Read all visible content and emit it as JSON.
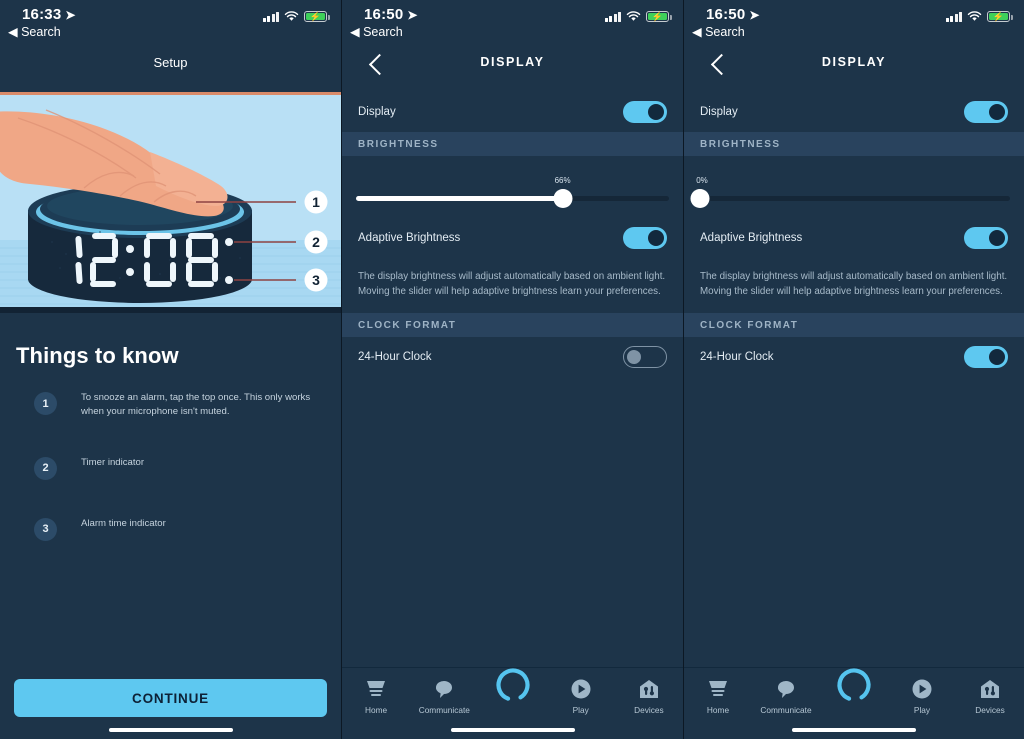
{
  "panels": [
    {
      "status": {
        "time": "16:33",
        "back": "◀ Search",
        "location_icon": "location-arrow-icon",
        "signal_icon": "signal-bars-icon",
        "wifi_icon": "wifi-icon",
        "battery_icon": "battery-charging-icon"
      },
      "nav": {
        "title": "Setup",
        "has_back": false
      },
      "illustration": {
        "alt": "echo-dot-with-clock-illustration",
        "clock_display": "12:08",
        "callouts": [
          "1",
          "2",
          "3"
        ],
        "bg_color": "#b9e0f5",
        "device_color": "#16293c",
        "hand_color": "#f0a786"
      },
      "things_title": "Things to know",
      "things_items": [
        {
          "num": "1",
          "text": "To snooze an alarm, tap the top once. This only works when your microphone isn't muted."
        },
        {
          "num": "2",
          "text": "Timer indicator"
        },
        {
          "num": "3",
          "text": "Alarm time indicator"
        }
      ],
      "continue_label": "CONTINUE"
    },
    {
      "status": {
        "time": "16:50",
        "back": "◀ Search",
        "location_icon": "location-arrow-icon",
        "signal_icon": "signal-bars-icon",
        "wifi_icon": "wifi-icon",
        "battery_icon": "battery-charging-icon"
      },
      "nav": {
        "title": "DISPLAY",
        "has_back": true
      },
      "display_row": {
        "label": "Display",
        "state": "on"
      },
      "brightness_header": "BRIGHTNESS",
      "brightness": {
        "percent_label": "66%",
        "value": 66
      },
      "adaptive_row": {
        "label": "Adaptive Brightness",
        "state": "on"
      },
      "description": "The display brightness will adjust automatically based on ambient light. Moving the slider will help adaptive brightness learn your preferences.",
      "clock_format_header": "CLOCK FORMAT",
      "clock_row": {
        "label": "24-Hour Clock",
        "state": "off"
      }
    },
    {
      "status": {
        "time": "16:50",
        "back": "◀ Search",
        "location_icon": "location-arrow-icon",
        "signal_icon": "signal-bars-icon",
        "wifi_icon": "wifi-icon",
        "battery_icon": "battery-charging-icon"
      },
      "nav": {
        "title": "DISPLAY",
        "has_back": true
      },
      "display_row": {
        "label": "Display",
        "state": "on"
      },
      "brightness_header": "BRIGHTNESS",
      "brightness": {
        "percent_label": "0%",
        "value": 0
      },
      "adaptive_row": {
        "label": "Adaptive Brightness",
        "state": "on"
      },
      "description": "The display brightness will adjust automatically based on ambient light. Moving the slider will help adaptive brightness learn your preferences.",
      "clock_format_header": "CLOCK FORMAT",
      "clock_row": {
        "label": "24-Hour Clock",
        "state": "on"
      }
    }
  ],
  "tabbar": {
    "items": [
      {
        "label": "Home",
        "icon": "home-icon",
        "active": false
      },
      {
        "label": "Communicate",
        "icon": "speech-bubble-icon",
        "active": false
      },
      {
        "label": "",
        "icon": "alexa-ring-icon",
        "active": true
      },
      {
        "label": "Play",
        "icon": "play-circle-icon",
        "active": false
      },
      {
        "label": "Devices",
        "icon": "devices-house-icon",
        "active": false
      }
    ]
  },
  "colors": {
    "panel_bg": "#1d3449",
    "section_bg": "#29435e",
    "accent": "#5ec8f0",
    "track_off": "#152738",
    "text_primary": "#e3ecf3",
    "text_secondary": "#a8bbca"
  }
}
